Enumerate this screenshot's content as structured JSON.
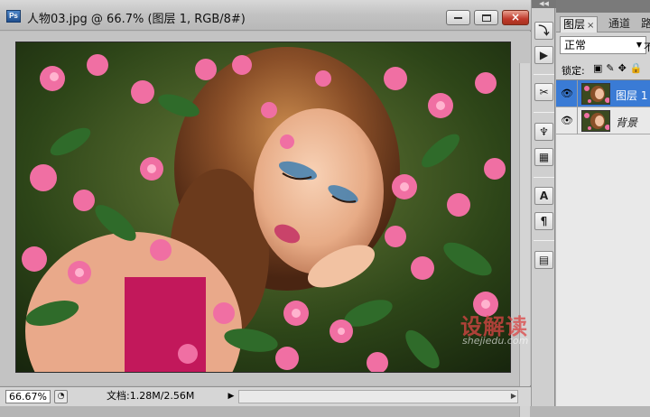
{
  "window": {
    "app_icon": "ps-icon",
    "title": "人物03.jpg @ 66.7% (图层 1, RGB/8#)",
    "buttons": {
      "minimize": "minimize",
      "maximize": "maximize",
      "close": "×"
    }
  },
  "status": {
    "zoom": "66.67%",
    "doc_info": "文档:1.28M/2.56M",
    "menu_arrow": "▶"
  },
  "watermark": {
    "text": "设解读",
    "url": "shejiedu.com"
  },
  "dock": {
    "buttons": [
      "history-icon",
      "actions-icon",
      "tool-presets-icon",
      "clone-source-icon",
      "brush-presets-icon",
      "character-icon",
      "paragraph-icon",
      "layer-comps-icon"
    ],
    "glyphs": [
      "⤵",
      "▶",
      "✂",
      "♆",
      "▦",
      "A",
      "¶",
      "▤"
    ]
  },
  "layers_panel": {
    "tabs": [
      {
        "label": "图层",
        "close": "×"
      },
      {
        "label": "通道"
      },
      {
        "label": "路"
      }
    ],
    "blend_mode": "正常",
    "opacity_peek": "不",
    "lock_label": "锁定:",
    "lock_icons": "▣✎✥🔒",
    "layers": [
      {
        "name": "图层 1",
        "visible_icon": "eye-icon",
        "selected": true
      },
      {
        "name": "背景",
        "visible_icon": "eye-icon",
        "selected": false
      }
    ]
  },
  "colors": {
    "selection": "#3a7bd5",
    "close_button": "#c0392b",
    "watermark": "#dc4646"
  }
}
